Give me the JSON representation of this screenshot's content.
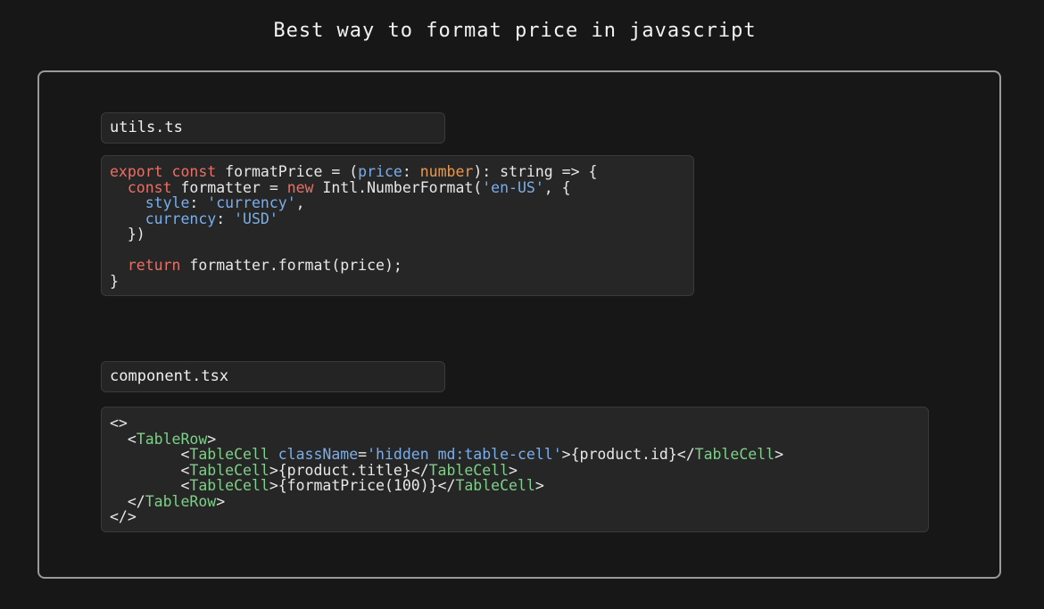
{
  "page": {
    "title": "Best way to format price in javascript"
  },
  "colors": {
    "background": "#171717",
    "frame_border": "#9a9a9a",
    "keyword": "#ea6f64",
    "identifier_blue": "#7aaeea",
    "type_orange": "#e89a50",
    "jsx_tag": "#7fcf89"
  },
  "files": [
    {
      "name": "utils.ts",
      "lines": [
        [
          [
            "kw",
            "export const"
          ],
          [
            "plain",
            " formatPrice = ("
          ],
          [
            "param",
            "price"
          ],
          [
            "plain",
            ": "
          ],
          [
            "type",
            "number"
          ],
          [
            "plain",
            "): string => {"
          ]
        ],
        [
          [
            "plain",
            "  "
          ],
          [
            "kw",
            "const"
          ],
          [
            "plain",
            " formatter = "
          ],
          [
            "kw",
            "new"
          ],
          [
            "plain",
            " Intl.NumberFormat("
          ],
          [
            "str",
            "'en-US'"
          ],
          [
            "plain",
            ", {"
          ]
        ],
        [
          [
            "plain",
            "    "
          ],
          [
            "prop",
            "style"
          ],
          [
            "plain",
            ": "
          ],
          [
            "str",
            "'currency'"
          ],
          [
            "plain",
            ","
          ]
        ],
        [
          [
            "plain",
            "    "
          ],
          [
            "prop",
            "currency"
          ],
          [
            "plain",
            ": "
          ],
          [
            "str",
            "'USD'"
          ]
        ],
        [
          [
            "plain",
            "  })"
          ]
        ],
        [
          [
            "plain",
            ""
          ]
        ],
        [
          [
            "plain",
            "  "
          ],
          [
            "kw",
            "return"
          ],
          [
            "plain",
            " formatter.format(price);"
          ]
        ],
        [
          [
            "plain",
            "}"
          ]
        ]
      ]
    },
    {
      "name": "component.tsx",
      "lines": [
        [
          [
            "plain",
            "<>"
          ]
        ],
        [
          [
            "plain",
            "  <"
          ],
          [
            "tag",
            "TableRow"
          ],
          [
            "plain",
            ">"
          ]
        ],
        [
          [
            "plain",
            "        <"
          ],
          [
            "tag",
            "TableCell"
          ],
          [
            "plain",
            " "
          ],
          [
            "attr",
            "className"
          ],
          [
            "plain",
            "="
          ],
          [
            "str",
            "'hidden md:table-cell'"
          ],
          [
            "plain",
            ">{product.id}</"
          ],
          [
            "tag",
            "TableCell"
          ],
          [
            "plain",
            ">"
          ]
        ],
        [
          [
            "plain",
            "        <"
          ],
          [
            "tag",
            "TableCell"
          ],
          [
            "plain",
            ">{product.title}</"
          ],
          [
            "tag",
            "TableCell"
          ],
          [
            "plain",
            ">"
          ]
        ],
        [
          [
            "plain",
            "        <"
          ],
          [
            "tag",
            "TableCell"
          ],
          [
            "plain",
            ">{formatPrice(100)}</"
          ],
          [
            "tag",
            "TableCell"
          ],
          [
            "plain",
            ">"
          ]
        ],
        [
          [
            "plain",
            "  </"
          ],
          [
            "tag",
            "TableRow"
          ],
          [
            "plain",
            ">"
          ]
        ],
        [
          [
            "plain",
            "</>"
          ]
        ]
      ]
    }
  ]
}
